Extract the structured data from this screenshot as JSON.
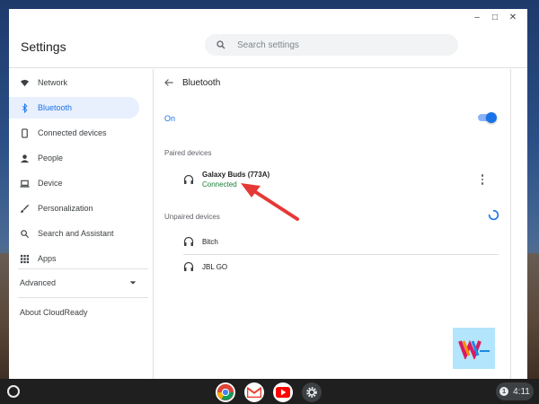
{
  "window": {
    "minimize_label": "–",
    "maximize_label": "□",
    "close_label": "✕"
  },
  "header": {
    "title": "Settings",
    "search_placeholder": "Search settings"
  },
  "sidebar": {
    "items": [
      {
        "label": "Network",
        "icon": "wifi-icon"
      },
      {
        "label": "Bluetooth",
        "icon": "bluetooth-icon"
      },
      {
        "label": "Connected devices",
        "icon": "phone-icon"
      },
      {
        "label": "People",
        "icon": "person-icon"
      },
      {
        "label": "Device",
        "icon": "laptop-icon"
      },
      {
        "label": "Personalization",
        "icon": "brush-icon"
      },
      {
        "label": "Search and Assistant",
        "icon": "search-icon"
      },
      {
        "label": "Apps",
        "icon": "apps-grid-icon"
      }
    ],
    "advanced_label": "Advanced",
    "about_label": "About CloudReady"
  },
  "content": {
    "page_title": "Bluetooth",
    "toggle_label": "On",
    "paired_header": "Paired devices",
    "paired_devices": [
      {
        "name": "Galaxy Buds (773A)",
        "status": "Connected"
      }
    ],
    "unpaired_header": "Unpaired devices",
    "unpaired_devices": [
      {
        "name": "Bitch"
      },
      {
        "name": "JBL GO"
      }
    ]
  },
  "taskbar": {
    "apps": [
      "chrome-icon",
      "gmail-icon",
      "youtube-icon",
      "settings-gear-icon"
    ],
    "notification_count": "1",
    "time": "4:11"
  },
  "colors": {
    "accent": "#1a73e8",
    "connected": "#188038",
    "annotation_arrow": "#e53935"
  }
}
